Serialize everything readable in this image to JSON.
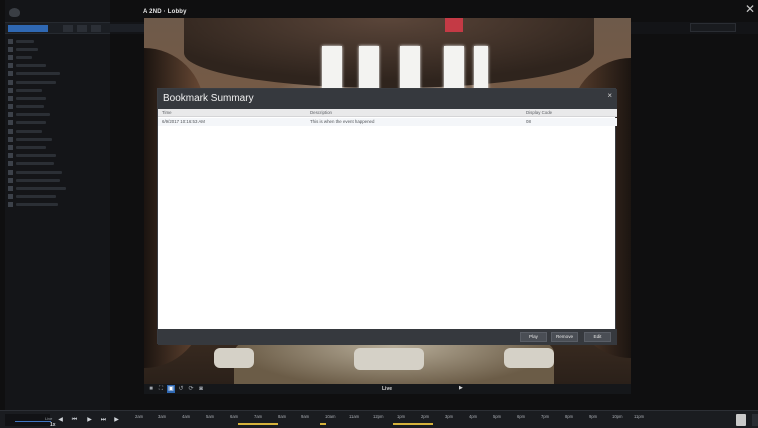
{
  "camera": {
    "title": "A 2ND · Lobby"
  },
  "dialog": {
    "title": "Bookmark Summary",
    "close": "×",
    "columns": {
      "time": "Time",
      "description": "Description",
      "display_code": "Display Code"
    },
    "rows": [
      {
        "time": "6/9/2017 10:16:53 AM",
        "description": "This is when the event happened",
        "display_code": "08"
      }
    ],
    "buttons": {
      "play": "Play",
      "remove": "Remove",
      "edit": "Edit"
    }
  },
  "video_toolbar": {
    "live_label": "Live",
    "icons": [
      "stop-icon",
      "fullscreen-icon",
      "layout-icon",
      "back-icon",
      "refresh-icon",
      "camera-icon"
    ]
  },
  "timeline": {
    "speed_label": "Live",
    "speed_value": "1x",
    "controls": [
      "prev-icon",
      "step-back-icon",
      "play-icon",
      "step-forward-icon",
      "next-icon"
    ],
    "ticks": [
      "2am",
      "3am",
      "4am",
      "5am",
      "6am",
      "7am",
      "8am",
      "9am",
      "10am",
      "11am",
      "12pm",
      "1pm",
      "2pm",
      "3pm",
      "4pm",
      "5pm",
      "6pm",
      "7pm",
      "8pm",
      "9pm",
      "10pm",
      "11pm"
    ]
  },
  "colors": {
    "accent": "#2f68b3",
    "marker": "#d6b23b",
    "dialog_header": "#36393e"
  }
}
